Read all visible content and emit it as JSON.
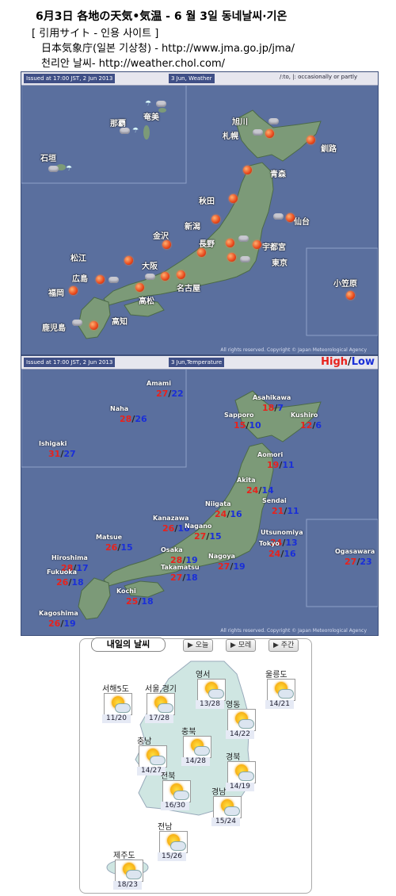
{
  "header": {
    "title": "6月3日 各地の天気•気温 - 6 월 3일 동네날씨·기온",
    "line2": "[ 引用サイト - 인용 사이트 ]",
    "line3": "日本気象庁(일본 기상청) - http://www.jma.go.jp/jma/",
    "line4": "천리안 날씨- http://weather.chol.com/"
  },
  "weather_map": {
    "issued": "Issued at 17:00 JST, 2 Jun 2013",
    "date_label": "3 Jun, Weather",
    "legend_note": "/:to, |: occasionally or partly",
    "copyright": "All rights reserved. Copyright © Japan Meteorological Agency",
    "cities": [
      "旭川",
      "札幌",
      "釧路",
      "青森",
      "秋田",
      "仙台",
      "新潟",
      "金沢",
      "長野",
      "宇都宮",
      "東京",
      "松江",
      "大阪",
      "広島",
      "名古屋",
      "高松",
      "福岡",
      "高知",
      "鹿児島",
      "那覇",
      "奄美",
      "石垣",
      "小笠原"
    ]
  },
  "temp_map": {
    "issued": "Issued at 17:00 JST, 2 Jun 2013",
    "date_label": "3 Jun,Temperature",
    "legend_high": "High",
    "legend_sep": "/",
    "legend_low": "Low",
    "copyright": "All rights reserved. Copyright © Japan Meteorological Agency",
    "stations": [
      {
        "name": "Amami",
        "hi": "27",
        "lo": "22"
      },
      {
        "name": "Naha",
        "hi": "28",
        "lo": "26"
      },
      {
        "name": "Ishigaki",
        "hi": "31",
        "lo": "27"
      },
      {
        "name": "Asahikawa",
        "hi": "18",
        "lo": "7"
      },
      {
        "name": "Sapporo",
        "hi": "15",
        "lo": "10"
      },
      {
        "name": "Kushiro",
        "hi": "12",
        "lo": "6"
      },
      {
        "name": "Aomori",
        "hi": "19",
        "lo": "11"
      },
      {
        "name": "Akita",
        "hi": "24",
        "lo": "14"
      },
      {
        "name": "Niigata",
        "hi": "24",
        "lo": "16"
      },
      {
        "name": "Sendai",
        "hi": "21",
        "lo": "11"
      },
      {
        "name": "Kanazawa",
        "hi": "26",
        "lo": "16"
      },
      {
        "name": "Nagano",
        "hi": "27",
        "lo": "15"
      },
      {
        "name": "Utsunomiya",
        "hi": "24",
        "lo": "13"
      },
      {
        "name": "Tokyo",
        "hi": "24",
        "lo": "16"
      },
      {
        "name": "Matsue",
        "hi": "26",
        "lo": "15"
      },
      {
        "name": "Osaka",
        "hi": "28",
        "lo": "19"
      },
      {
        "name": "Nagoya",
        "hi": "27",
        "lo": "19"
      },
      {
        "name": "Hiroshima",
        "hi": "28",
        "lo": "17"
      },
      {
        "name": "Fukuoka",
        "hi": "26",
        "lo": "18"
      },
      {
        "name": "Takamatsu",
        "hi": "27",
        "lo": "18"
      },
      {
        "name": "Kochi",
        "hi": "25",
        "lo": "18"
      },
      {
        "name": "Kagoshima",
        "hi": "26",
        "lo": "19"
      },
      {
        "name": "Ogasawara",
        "hi": "27",
        "lo": "23"
      }
    ]
  },
  "korea": {
    "tab_title": "내일의 날씨",
    "buttons": [
      "▶ 오늘",
      "▶ 모레",
      "▶ 주간"
    ],
    "regions": [
      {
        "name": "서해5도",
        "temp": "11/20"
      },
      {
        "name": "서울,경기",
        "temp": "17/28"
      },
      {
        "name": "영서",
        "temp": "13/28"
      },
      {
        "name": "울릉도",
        "temp": "14/21"
      },
      {
        "name": "영동",
        "temp": "14/22"
      },
      {
        "name": "충북",
        "temp": "14/28"
      },
      {
        "name": "충남",
        "temp": "14/27"
      },
      {
        "name": "경북",
        "temp": "14/19"
      },
      {
        "name": "전북",
        "temp": "16/30"
      },
      {
        "name": "경남",
        "temp": "15/24"
      },
      {
        "name": "전남",
        "temp": "15/26"
      },
      {
        "name": "제주도",
        "temp": "18/23"
      }
    ]
  },
  "colors": {
    "map_sea": "#5a6f9e",
    "land": "#7c9a78",
    "high": "#e8221c",
    "low": "#1a2fd8"
  }
}
